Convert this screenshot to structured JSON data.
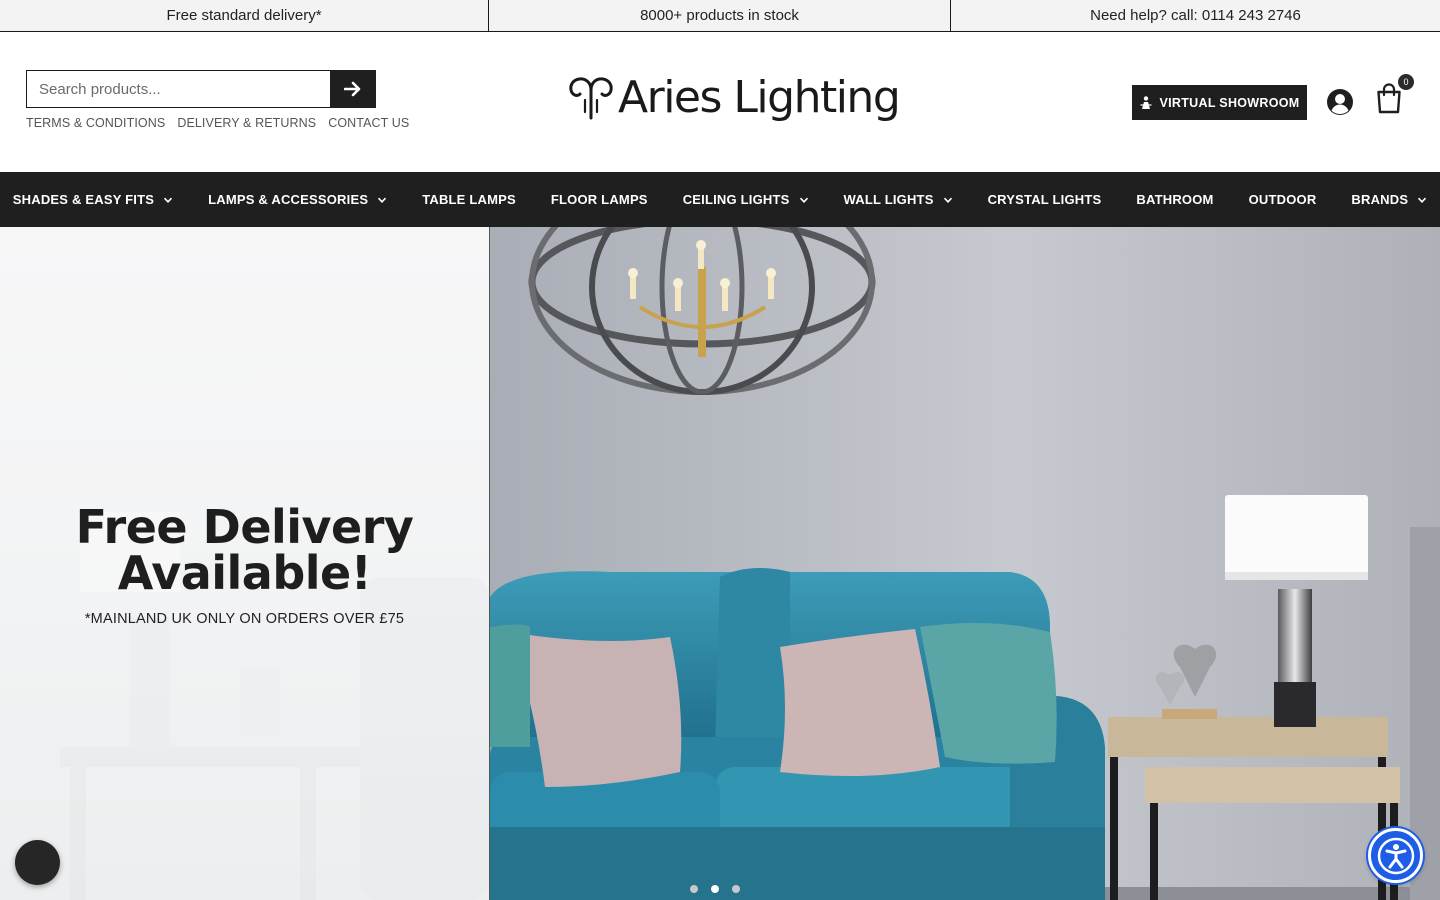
{
  "topbar": {
    "delivery": "Free standard delivery*",
    "stock": "8000+ products in stock",
    "help": "Need help? call: 0114 243 2746"
  },
  "header": {
    "search_placeholder": "Search products...",
    "links": [
      "TERMS & CONDITIONS",
      "DELIVERY & RETURNS",
      "CONTACT US"
    ],
    "logo_text": "Aries Lighting",
    "virtual_showroom": "VIRTUAL SHOWROOM",
    "cart_count": "0"
  },
  "nav": {
    "items": [
      {
        "label": "SHADES & EASY FITS",
        "dropdown": true
      },
      {
        "label": "LAMPS & ACCESSORIES",
        "dropdown": true
      },
      {
        "label": "TABLE LAMPS",
        "dropdown": false
      },
      {
        "label": "FLOOR LAMPS",
        "dropdown": false
      },
      {
        "label": "CEILING LIGHTS",
        "dropdown": true
      },
      {
        "label": "WALL LIGHTS",
        "dropdown": true
      },
      {
        "label": "CRYSTAL LIGHTS",
        "dropdown": false
      },
      {
        "label": "BATHROOM",
        "dropdown": false
      },
      {
        "label": "OUTDOOR",
        "dropdown": false
      },
      {
        "label": "BRANDS",
        "dropdown": true
      }
    ]
  },
  "hero": {
    "title_line1": "Free Delivery",
    "title_line2": "Available!",
    "subtitle": "*MAINLAND UK ONLY ON ORDERS OVER £75",
    "slide_count": 3,
    "active_slide": 2
  },
  "colors": {
    "dark": "#1f1f1f",
    "topbar_bg": "#f3f3f3",
    "accessibility_blue": "#1e5ee6",
    "sofa_teal": "#2e8aa6"
  },
  "icons": {
    "search": "arrow-right-icon",
    "showroom": "person-figure-icon",
    "account": "user-circle-icon",
    "cart": "shopping-bag-icon",
    "chat": "chat-icon",
    "accessibility": "accessibility-icon"
  }
}
